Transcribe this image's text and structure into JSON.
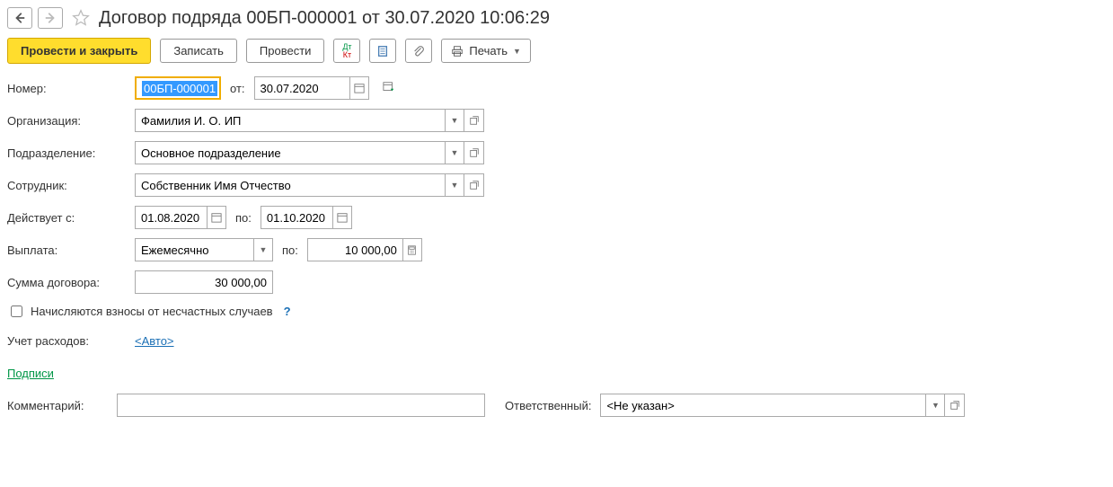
{
  "header": {
    "title": "Договор подряда 00БП-000001 от 30.07.2020 10:06:29"
  },
  "toolbar": {
    "post_close": "Провести и закрыть",
    "save": "Записать",
    "post": "Провести",
    "print": "Печать"
  },
  "fields": {
    "number_label": "Номер:",
    "number_value": "00БП-000001",
    "from_label": "от:",
    "date_value": "30.07.2020",
    "org_label": "Организация:",
    "org_value": "Фамилия И. О. ИП",
    "dept_label": "Подразделение:",
    "dept_value": "Основное подразделение",
    "employee_label": "Сотрудник:",
    "employee_value": "Собственник Имя Отчество",
    "valid_from_label": "Действует с:",
    "valid_from": "01.08.2020",
    "to_label": "по:",
    "valid_to": "01.10.2020",
    "payout_label": "Выплата:",
    "payout_value": "Ежемесячно",
    "payout_to_label": "по:",
    "payout_amount": "10 000,00",
    "total_label": "Сумма договора:",
    "total_value": "30 000,00",
    "accident_label": "Начисляются взносы от несчастных случаев",
    "expense_label": "Учет расходов:",
    "expense_value": "<Авто>",
    "signatures": "Подписи",
    "comment_label": "Комментарий:",
    "comment_value": "",
    "responsible_label": "Ответственный:",
    "responsible_value": "<Не указан>"
  }
}
